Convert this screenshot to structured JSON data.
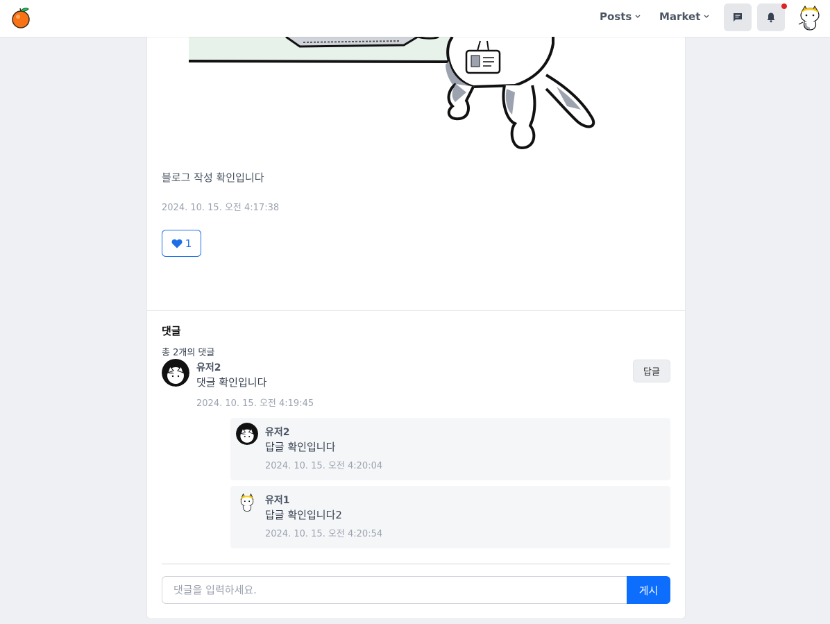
{
  "header": {
    "nav": [
      {
        "label": "Posts"
      },
      {
        "label": "Market"
      }
    ],
    "icons": {
      "chat": "chat-icon",
      "bell": "bell-icon"
    },
    "has_notification": true
  },
  "post": {
    "body": "블로그 작성 확인입니다",
    "date": "2024. 10. 15. 오전 4:17:38",
    "likes": "1"
  },
  "comments": {
    "title": "댓글",
    "count_text": "총 2개의 댓글",
    "items": [
      {
        "author": "유저2",
        "text": "댓글 확인입니다",
        "date": "2024. 10. 15. 오전 4:19:45",
        "reply_label": "답글",
        "replies": [
          {
            "author": "유저2",
            "text": "답글 확인입니다",
            "date": "2024. 10. 15. 오전 4:20:04"
          },
          {
            "author": "유저1",
            "text": "답글 확인입니다2",
            "date": "2024. 10. 15. 오전 4:20:54"
          }
        ]
      }
    ],
    "input_placeholder": "댓글을 입력하세요.",
    "submit_label": "게시"
  },
  "colors": {
    "accent": "#0d6efd",
    "like": "#1d6fe8",
    "notification": "#dc2626"
  }
}
